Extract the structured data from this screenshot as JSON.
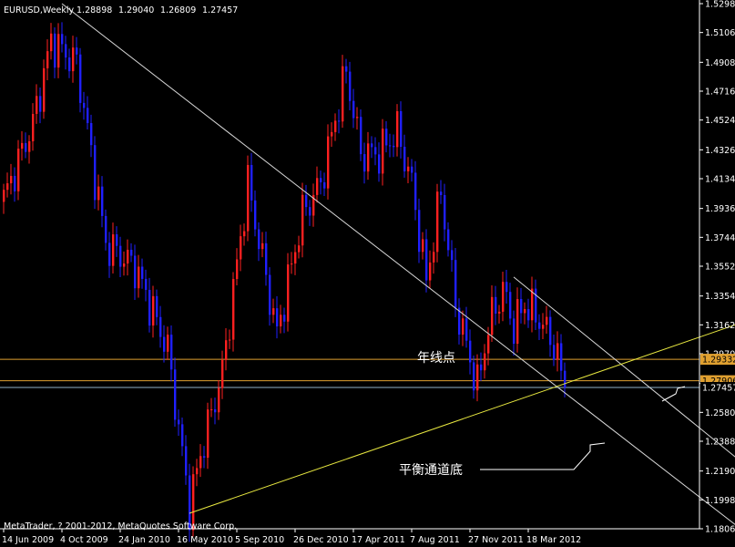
{
  "chart_data": {
    "type": "candlestick",
    "symbol_header": "EURUSD,Weekly",
    "ohlc_header": [
      "1.28898",
      "1.29040",
      "1.26809",
      "1.27457"
    ],
    "copyright": "MetaTrader, ? 2001-2012, MetaQuotes Software Corp.",
    "ylim": [
      1.1806,
      1.5298
    ],
    "y_ticks": [
      1.5298,
      1.5106,
      1.4908,
      1.4716,
      1.4524,
      1.4326,
      1.4134,
      1.3936,
      1.3744,
      1.3552,
      1.3354,
      1.3162,
      1.297,
      1.2772,
      1.258,
      1.2388,
      1.219,
      1.1998,
      1.1806
    ],
    "y_tick_labels": [
      "1.52980",
      "1.51060",
      "1.49080",
      "1.47160",
      "1.45240",
      "1.43260",
      "1.41340",
      "1.39360",
      "1.37440",
      "1.35520",
      "1.33540",
      "1.31620",
      "1.29700",
      "1.27720",
      "1.25800",
      "1.23880",
      "1.21900",
      "1.19980",
      "1.18060"
    ],
    "x_ticks": [
      {
        "label": "14 Jun 2009",
        "index": 0
      },
      {
        "label": "4 Oct 2009",
        "index": 16
      },
      {
        "label": "24 Jan 2010",
        "index": 32
      },
      {
        "label": "16 May 2010",
        "index": 48
      },
      {
        "label": "5 Sep 2010",
        "index": 64
      },
      {
        "label": "26 Dec 2010",
        "index": 80
      },
      {
        "label": "17 Apr 2011",
        "index": 96
      },
      {
        "label": "7 Aug 2011",
        "index": 112
      },
      {
        "label": "27 Nov 2011",
        "index": 128
      },
      {
        "label": "18 Mar 2012",
        "index": 144
      }
    ],
    "bar_count": 155,
    "key_points": [
      {
        "index": 0,
        "close": 1.4
      },
      {
        "index": 8,
        "close": 1.45
      },
      {
        "index": 13,
        "close": 1.505
      },
      {
        "index": 20,
        "close": 1.49
      },
      {
        "index": 28,
        "close": 1.37
      },
      {
        "index": 36,
        "close": 1.355
      },
      {
        "index": 45,
        "close": 1.3
      },
      {
        "index": 51,
        "close": 1.195
      },
      {
        "index": 54,
        "close": 1.23
      },
      {
        "index": 60,
        "close": 1.285
      },
      {
        "index": 67,
        "close": 1.41
      },
      {
        "index": 75,
        "close": 1.31
      },
      {
        "index": 82,
        "close": 1.39
      },
      {
        "index": 87,
        "close": 1.41
      },
      {
        "index": 94,
        "close": 1.485
      },
      {
        "index": 98,
        "close": 1.43
      },
      {
        "index": 103,
        "close": 1.43
      },
      {
        "index": 108,
        "close": 1.445
      },
      {
        "index": 112,
        "close": 1.41
      },
      {
        "index": 116,
        "close": 1.345
      },
      {
        "index": 120,
        "close": 1.405
      },
      {
        "index": 124,
        "close": 1.33
      },
      {
        "index": 130,
        "close": 1.275
      },
      {
        "index": 133,
        "close": 1.315
      },
      {
        "index": 137,
        "close": 1.34
      },
      {
        "index": 140,
        "close": 1.315
      },
      {
        "index": 143,
        "close": 1.33
      },
      {
        "index": 147,
        "close": 1.32
      },
      {
        "index": 151,
        "close": 1.303
      },
      {
        "index": 154,
        "close": 1.2746
      }
    ],
    "horizontal_lines": [
      {
        "price": 1.29332,
        "label": "1.29332",
        "color": "#e0a030",
        "label_bg": "#e0a030"
      },
      {
        "price": 1.27906,
        "label": "1.27906",
        "color": "#e0a030",
        "label_bg": "#e0a030"
      },
      {
        "price": 1.27457,
        "label": "1.27457",
        "color": "#8fb0c8",
        "label_bg": "#000000"
      }
    ],
    "trendlines": [
      {
        "color": "#d8d8d8",
        "from": {
          "index": 16,
          "price": 1.5298
        },
        "to": {
          "index": 201,
          "price": 1.183
        }
      },
      {
        "color": "#d8d8d8",
        "from": {
          "index": 140,
          "price": 1.348
        },
        "to": {
          "index": 201,
          "price": 1.228
        }
      },
      {
        "color": "#e8e840",
        "from": {
          "index": 51,
          "price": 1.1909
        },
        "to": {
          "index": 201,
          "price": 1.3164
        }
      }
    ],
    "annotations": [
      {
        "text": "年线点",
        "label_key": "ann_year"
      },
      {
        "text": "平衡通道底",
        "label_key": "ann_bottom"
      }
    ],
    "colors": {
      "up": "#ff2020",
      "down": "#2020ff",
      "background": "#000000",
      "axis": "#ffffff"
    }
  }
}
